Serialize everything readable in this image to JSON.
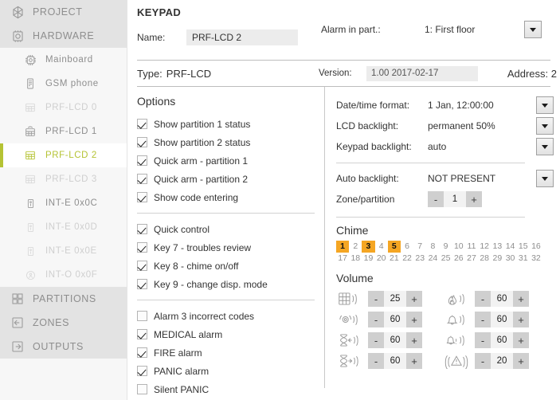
{
  "sidebar": {
    "items": [
      {
        "label": "PROJECT",
        "icon": "project-icon",
        "level": "top",
        "state": "group"
      },
      {
        "label": "HARDWARE",
        "icon": "hardware-icon",
        "level": "top",
        "state": "group"
      },
      {
        "label": "Mainboard",
        "icon": "chip-icon",
        "level": "sub",
        "state": "normal"
      },
      {
        "label": "GSM phone",
        "icon": "phone-icon",
        "level": "sub",
        "state": "normal"
      },
      {
        "label": "PRF-LCD 0",
        "icon": "keypad-icon",
        "level": "sub",
        "state": "dim"
      },
      {
        "label": "PRF-LCD 1",
        "icon": "keypad-wireless-icon",
        "level": "sub",
        "state": "normal"
      },
      {
        "label": "PRF-LCD 2",
        "icon": "keypad-icon",
        "level": "sub",
        "state": "active"
      },
      {
        "label": "PRF-LCD 3",
        "icon": "keypad-icon",
        "level": "sub",
        "state": "dim"
      },
      {
        "label": "INT-E 0x0C",
        "icon": "module-icon",
        "level": "sub",
        "state": "normal"
      },
      {
        "label": "INT-E 0x0D",
        "icon": "module-icon",
        "level": "sub",
        "state": "dim"
      },
      {
        "label": "INT-E 0x0E",
        "icon": "module-icon",
        "level": "sub",
        "state": "dim"
      },
      {
        "label": "INT-O 0x0F",
        "icon": "module-round-icon",
        "level": "sub",
        "state": "dim"
      },
      {
        "label": "PARTITIONS",
        "icon": "partitions-icon",
        "level": "top",
        "state": "group"
      },
      {
        "label": "ZONES",
        "icon": "zones-icon",
        "level": "top",
        "state": "group"
      },
      {
        "label": "OUTPUTS",
        "icon": "outputs-icon",
        "level": "top",
        "state": "group"
      }
    ],
    "accent_color": "#b5c334"
  },
  "header": {
    "title": "KEYPAD",
    "name_label": "Name:",
    "name_value": "PRF-LCD 2",
    "alarm_part_label": "Alarm in part.:",
    "alarm_part_value": "1: First floor",
    "type_label": "Type:",
    "type_value": "PRF-LCD",
    "version_label": "Version:",
    "version_value": "1.00 2017-02-17",
    "address_label": "Address:",
    "address_value": "2"
  },
  "options": {
    "title": "Options",
    "group1": [
      {
        "label": "Show partition 1 status",
        "checked": true
      },
      {
        "label": "Show partition 2 status",
        "checked": true
      },
      {
        "label": "Quick arm - partition 1",
        "checked": true
      },
      {
        "label": "Quick arm - partition 2",
        "checked": true
      },
      {
        "label": "Show code entering",
        "checked": true
      }
    ],
    "group2": [
      {
        "label": "Quick control",
        "checked": true
      },
      {
        "label": "Key 7 - troubles review",
        "checked": true
      },
      {
        "label": "Key 8 - chime on/off",
        "checked": true
      },
      {
        "label": "Key 9 - change disp. mode",
        "checked": true
      }
    ],
    "group3": [
      {
        "label": "Alarm 3 incorrect codes",
        "checked": false
      },
      {
        "label": "MEDICAL alarm",
        "checked": true
      },
      {
        "label": "FIRE alarm",
        "checked": true
      },
      {
        "label": "PANIC alarm",
        "checked": true
      },
      {
        "label": "Silent PANIC",
        "checked": false
      }
    ]
  },
  "settings": {
    "group1": [
      {
        "label": "Date/time format:",
        "value": "1 Jan, 12:00:00"
      },
      {
        "label": "LCD backlight:",
        "value": "permanent 50%"
      },
      {
        "label": "Keypad backlight:",
        "value": "auto"
      }
    ],
    "auto_backlight": {
      "label": "Auto backlight:",
      "value": "NOT PRESENT"
    },
    "zone_partition": {
      "label": "Zone/partition",
      "value": "1",
      "minus": "-",
      "plus": "+"
    }
  },
  "chime": {
    "title": "Chime",
    "cells": [
      {
        "n": "1",
        "on": true
      },
      {
        "n": "2",
        "on": false
      },
      {
        "n": "3",
        "on": true
      },
      {
        "n": "4",
        "on": false
      },
      {
        "n": "5",
        "on": true
      },
      {
        "n": "6",
        "on": false
      },
      {
        "n": "7",
        "on": false
      },
      {
        "n": "8",
        "on": false
      },
      {
        "n": "9",
        "on": false
      },
      {
        "n": "10",
        "on": false
      },
      {
        "n": "11",
        "on": false
      },
      {
        "n": "12",
        "on": false
      },
      {
        "n": "13",
        "on": false
      },
      {
        "n": "14",
        "on": false
      },
      {
        "n": "15",
        "on": false
      },
      {
        "n": "16",
        "on": false
      },
      {
        "n": "17",
        "on": false
      },
      {
        "n": "18",
        "on": false
      },
      {
        "n": "19",
        "on": false
      },
      {
        "n": "20",
        "on": false
      },
      {
        "n": "21",
        "on": false
      },
      {
        "n": "22",
        "on": false
      },
      {
        "n": "23",
        "on": false
      },
      {
        "n": "24",
        "on": false
      },
      {
        "n": "25",
        "on": false
      },
      {
        "n": "26",
        "on": false
      },
      {
        "n": "27",
        "on": false
      },
      {
        "n": "28",
        "on": false
      },
      {
        "n": "29",
        "on": false
      },
      {
        "n": "30",
        "on": false
      },
      {
        "n": "31",
        "on": false
      },
      {
        "n": "32",
        "on": false
      }
    ],
    "active_color": "#f5a623"
  },
  "volume": {
    "title": "Volume",
    "minus": "-",
    "plus": "+",
    "items": [
      {
        "icon": "keypad-sound-icon",
        "value": "25"
      },
      {
        "icon": "fire-sound-icon",
        "value": "60"
      },
      {
        "icon": "siren-sound-icon",
        "value": "60"
      },
      {
        "icon": "bell-sound-icon",
        "value": "60"
      },
      {
        "icon": "entry-delay-icon",
        "value": "60"
      },
      {
        "icon": "bell-alert-icon",
        "value": "60"
      },
      {
        "icon": "exit-delay-icon",
        "value": "60"
      },
      {
        "icon": "warning-sound-icon",
        "value": "20"
      }
    ]
  }
}
